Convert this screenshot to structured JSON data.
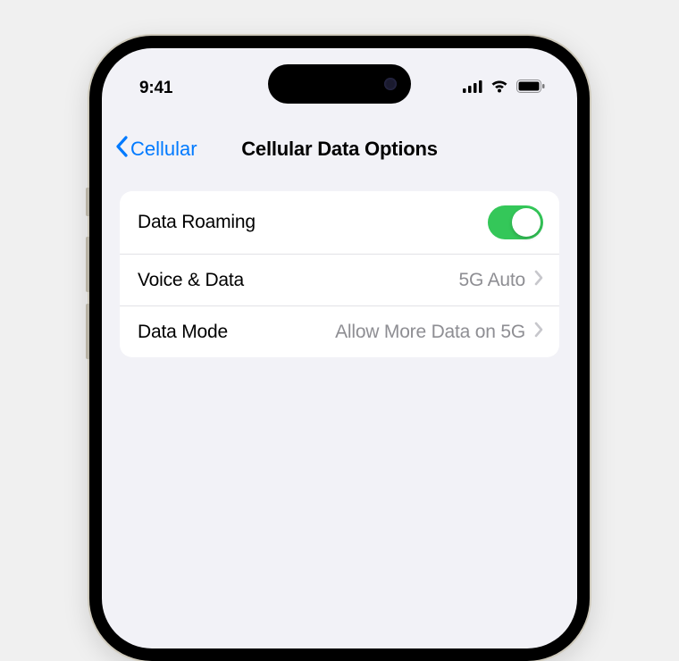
{
  "status": {
    "time": "9:41"
  },
  "nav": {
    "back_label": "Cellular",
    "title": "Cellular Data Options"
  },
  "settings": {
    "roaming": {
      "label": "Data Roaming",
      "enabled": true
    },
    "voice_data": {
      "label": "Voice & Data",
      "value": "5G Auto"
    },
    "data_mode": {
      "label": "Data Mode",
      "value": "Allow More Data on 5G"
    }
  },
  "colors": {
    "accent": "#007aff",
    "toggle_on": "#34c759",
    "secondary_text": "#8e8e93",
    "screen_bg": "#f2f2f7"
  }
}
